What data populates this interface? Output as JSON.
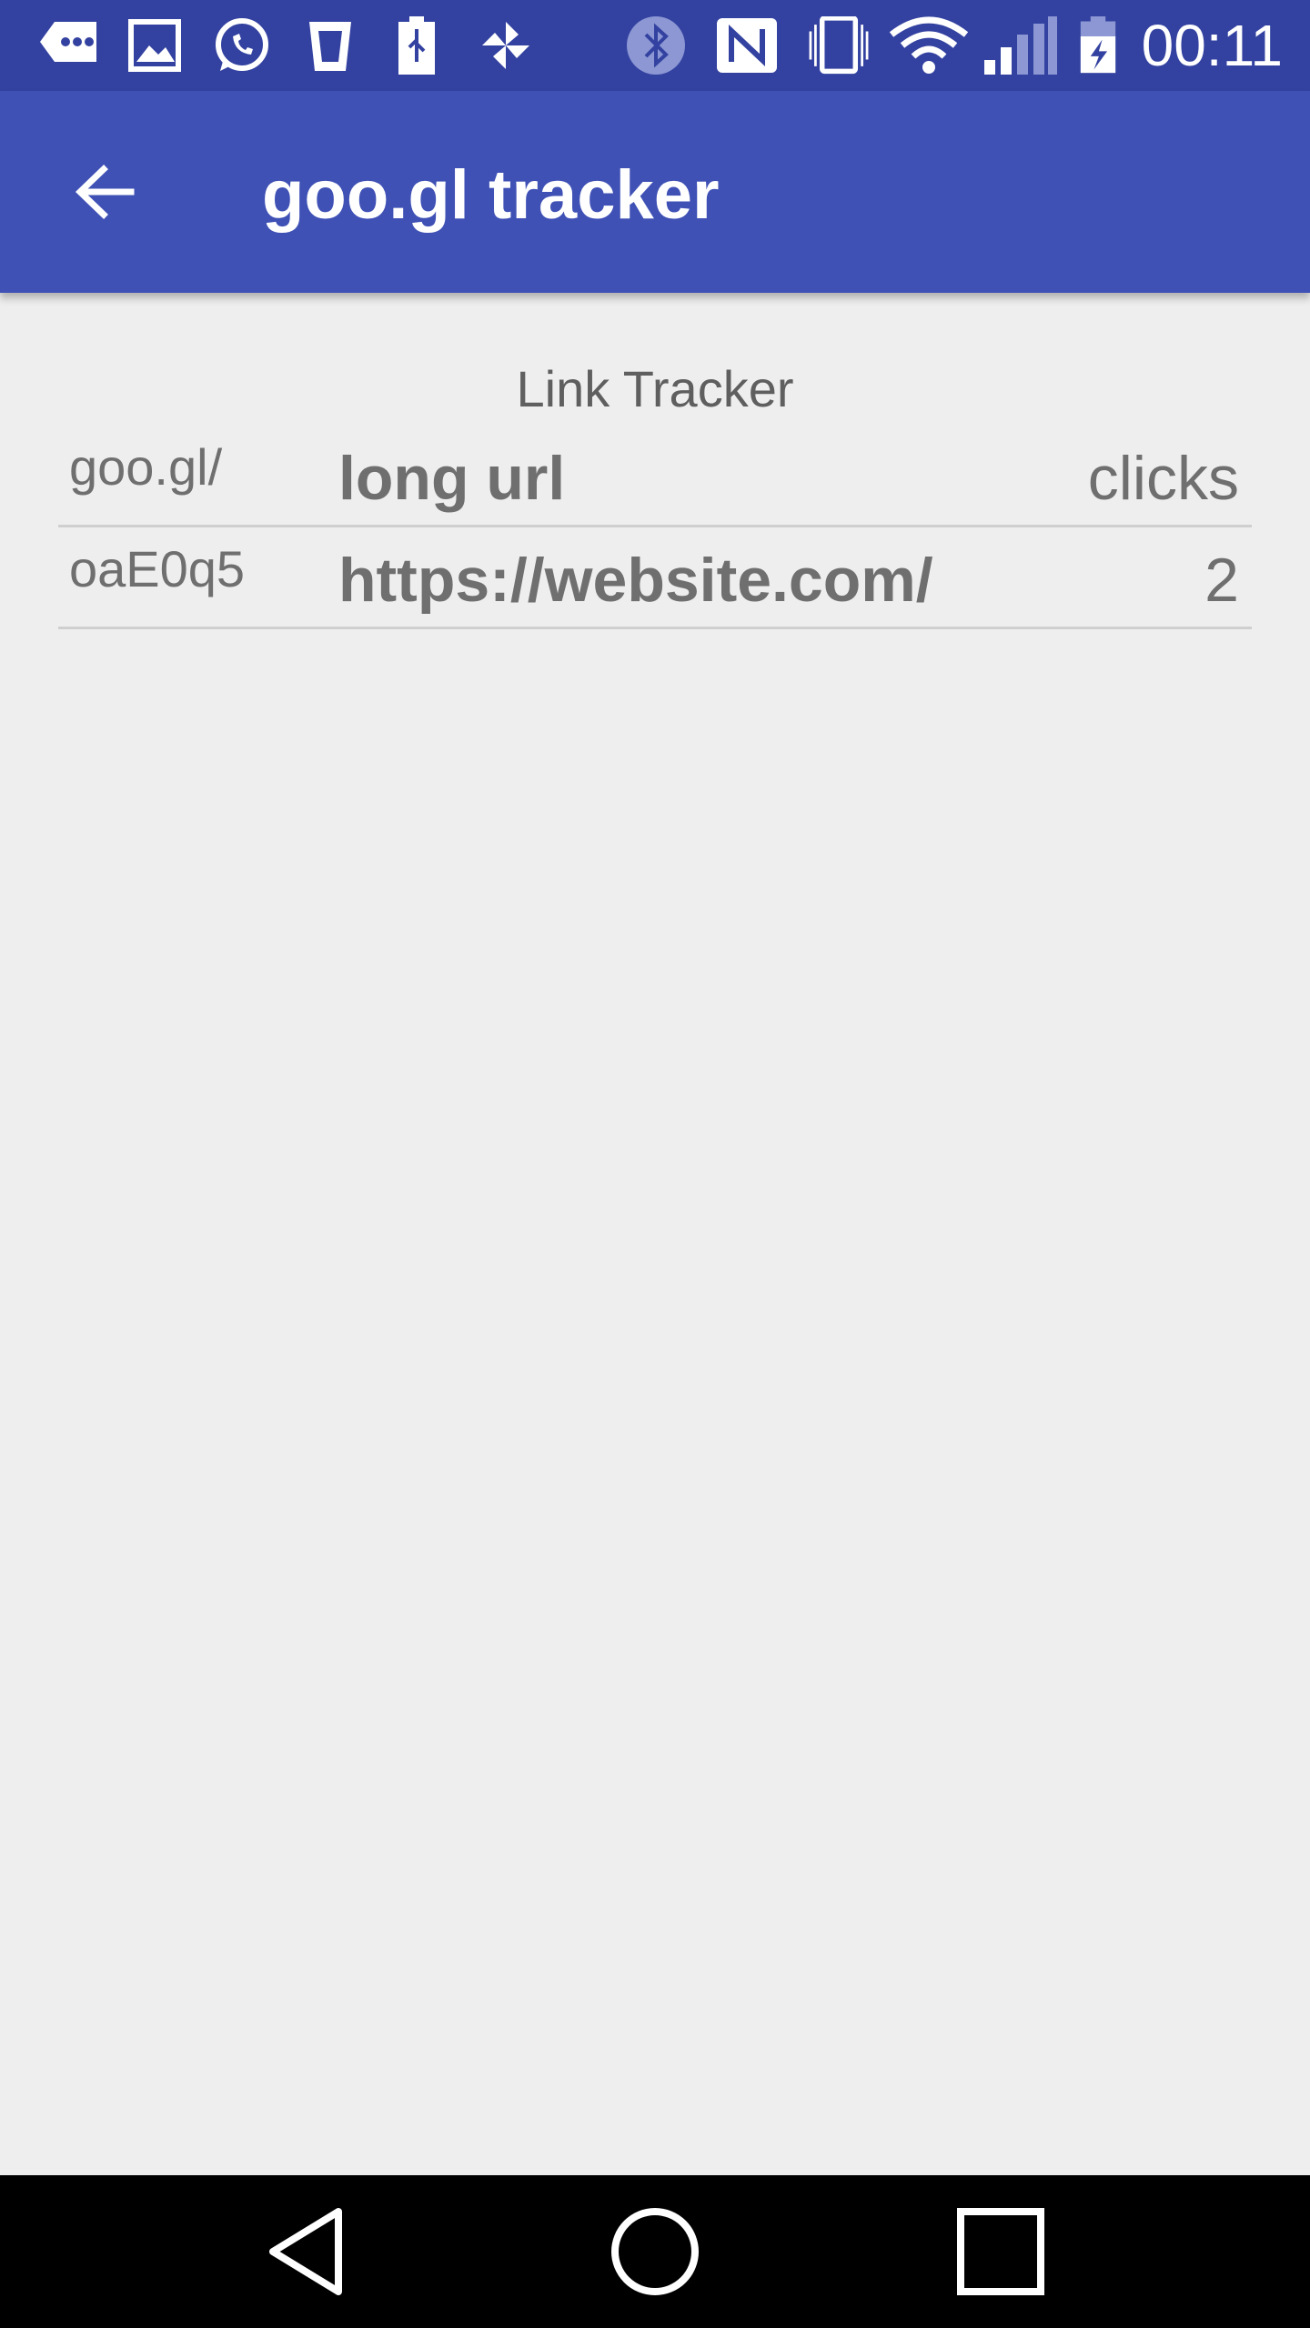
{
  "colors": {
    "status_bar": "#3342a0",
    "app_bar": "#3f51b5",
    "background": "#eeeeee",
    "nav_bar": "#000000",
    "text_primary": "#6f6f6f"
  },
  "status_bar": {
    "time": "00:11",
    "icons": [
      "message-more-icon",
      "image-icon",
      "whatsapp-icon",
      "cup-icon",
      "usb-battery-icon",
      "pinwheel-icon",
      "bluetooth-icon",
      "nfc-icon",
      "vibrate-icon",
      "wifi-icon",
      "signal-icon",
      "battery-charging-icon"
    ]
  },
  "app_bar": {
    "title": "goo.gl tracker",
    "back_icon": "arrow-back-icon"
  },
  "content": {
    "section_title": "Link Tracker",
    "table": {
      "headers": {
        "short": "goo.gl/",
        "long": "long url",
        "clicks": "clicks"
      },
      "rows": [
        {
          "short": "oaE0q5",
          "long": "https://website.com/",
          "clicks": "2"
        }
      ]
    }
  },
  "nav_bar": {
    "icons": [
      "back-triangle-icon",
      "home-circle-icon",
      "recents-square-icon"
    ]
  }
}
